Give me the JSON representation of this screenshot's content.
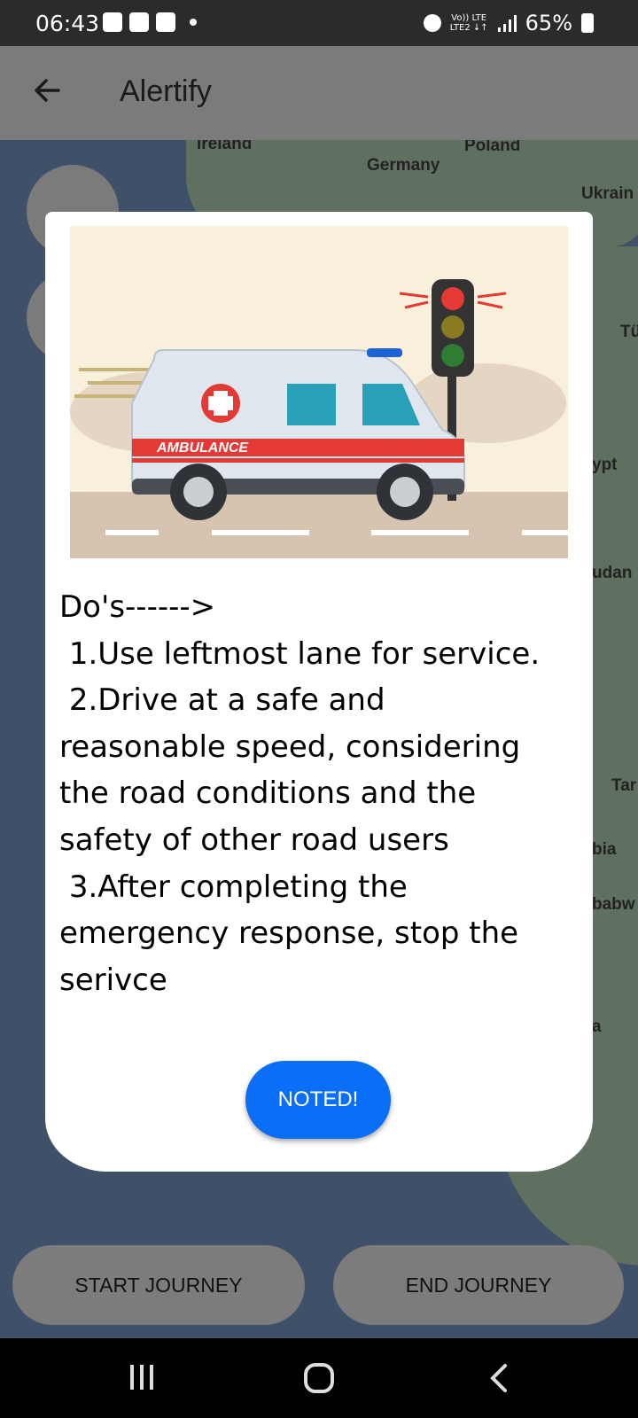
{
  "status_bar": {
    "time": "06:43",
    "network_top": "Vo)) LTE",
    "network_bottom": "LTE2 ↓↑",
    "battery": "65%"
  },
  "app_bar": {
    "title": "Alertify",
    "back_icon": "arrow-left-icon"
  },
  "map": {
    "labels": [
      "Ireland",
      "Germany",
      "Poland",
      "Ukrain",
      "Tü",
      "ypt",
      "udan",
      "Tar",
      "bia",
      "babw",
      "a"
    ]
  },
  "dialog": {
    "image_icon": "ambulance-illustration",
    "image_text": "AMBULANCE",
    "lines": [
      "Do's------>",
      " 1.Use leftmost lane for service.",
      " 2.Drive at a safe and",
      "reasonable speed, considering",
      "the road conditions and the",
      "safety of other road users",
      " 3.After completing the",
      "emergency response, stop the",
      "serivce"
    ],
    "button_label": "NOTED!",
    "button_color": "#0a6ef6"
  },
  "footer": {
    "start_label": "START JOURNEY",
    "end_label": "END JOURNEY"
  },
  "nav_bar": {
    "icons": [
      "recents-icon",
      "home-icon",
      "back-icon"
    ]
  }
}
